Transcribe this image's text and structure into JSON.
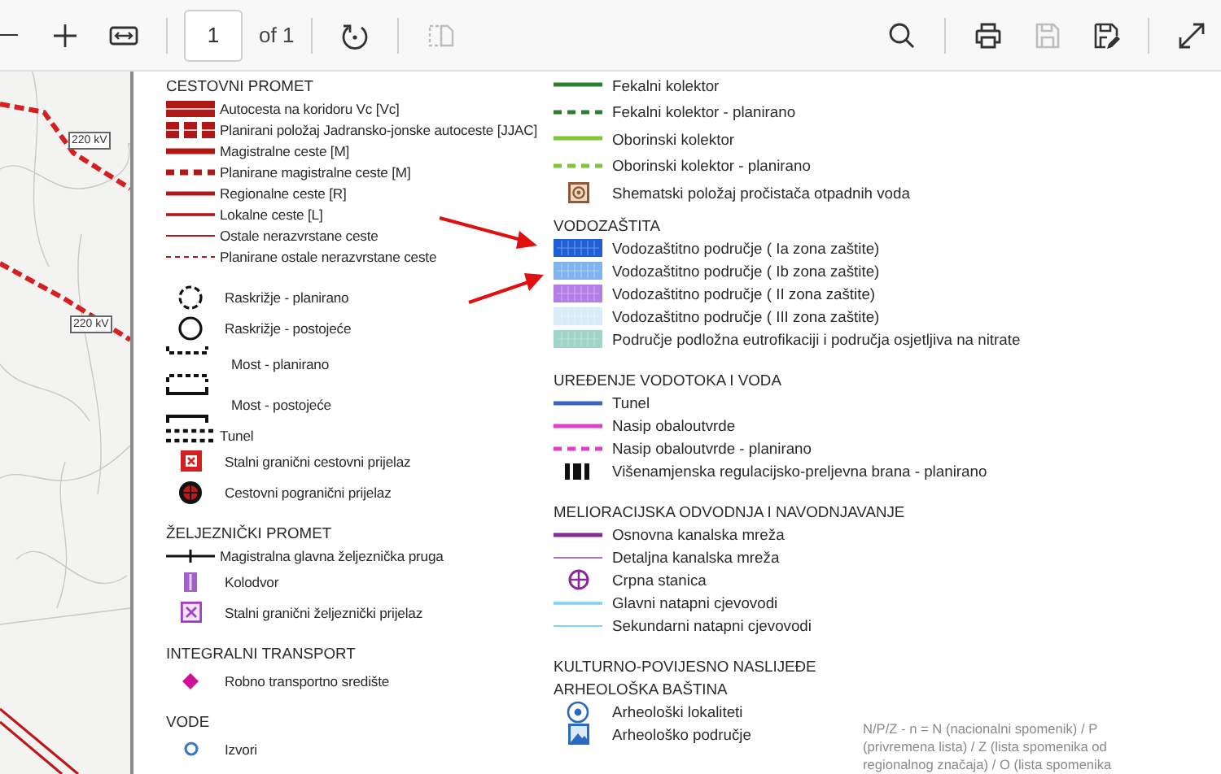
{
  "toolbar": {
    "buttons_left": [
      {
        "kind": "zoom-out",
        "disabled": false
      },
      {
        "kind": "zoom-in",
        "disabled": false
      },
      {
        "kind": "fit-width",
        "disabled": false
      }
    ],
    "page_input": {
      "value": "1"
    },
    "page_count": "of 1",
    "buttons_middle": [
      {
        "kind": "rotate",
        "disabled": false
      },
      {
        "kind": "two-page",
        "disabled": true
      }
    ],
    "buttons_right": [
      {
        "kind": "search",
        "disabled": false
      },
      {
        "kind": "print",
        "disabled": false
      },
      {
        "kind": "save",
        "disabled": true
      },
      {
        "kind": "save-as",
        "disabled": false
      },
      {
        "kind": "fullscreen",
        "disabled": false
      }
    ]
  },
  "map": {
    "labels": [
      "220 kV",
      "220 kV"
    ]
  },
  "legend": {
    "columns": [
      [
        {
          "title": "CESTOVNI PROMET",
          "items": [
            {
              "label": "Autocesta na koridoru Vc [Vc]",
              "kind": "band",
              "color": "#b01818"
            },
            {
              "label": "Planirani položaj Jadransko-jonske autoceste [JJAC]",
              "kind": "band-dashed",
              "color": "#b01818"
            },
            {
              "label": "Magistralne ceste [M]",
              "kind": "line-thick",
              "color": "#b01818"
            },
            {
              "label": "Planirane magistralne ceste [M]",
              "kind": "line-thick-dashed",
              "color": "#b01818"
            },
            {
              "label": "Regionalne ceste [R]",
              "kind": "line",
              "color": "#b01818"
            },
            {
              "label": "Lokalne ceste [L]",
              "kind": "line-medium",
              "color": "#b01818"
            },
            {
              "label": "Ostale nerazvrstane ceste",
              "kind": "line-thin",
              "color": "#b01818"
            },
            {
              "label": "Planirane ostale nerazvrstane ceste",
              "kind": "line-thin-dashed",
              "color": "#b01818"
            }
          ]
        },
        {
          "items": [
            {
              "label": "Raskrižje - planirano",
              "kind": "circle-dashed",
              "color": "#111111"
            },
            {
              "label": "Raskrižje - postojeće",
              "kind": "circle",
              "color": "#111111"
            },
            {
              "label": "Most - planirano",
              "kind": "bridge-dashed",
              "color": "#111111"
            },
            {
              "label": "Most - postojeće",
              "kind": "bridge",
              "color": "#111111"
            },
            {
              "label": "Tunel",
              "kind": "tunnel",
              "color": "#111111"
            },
            {
              "label": "Stalni granični cestovni prijelaz",
              "kind": "cross-square",
              "color": "#d42020"
            },
            {
              "label": "Cestovni pogranični prijelaz",
              "kind": "cross-circle",
              "color": "#c01818"
            }
          ]
        },
        {
          "title": "ŽELJEZNIČKI PROMET",
          "items": [
            {
              "label": "Magistralna glavna željeznička pruga",
              "kind": "rail",
              "color": "#111111"
            },
            {
              "label": "Kolodvor",
              "kind": "station",
              "color": "#a060c8"
            },
            {
              "label": "Stalni granični željeznički prijelaz",
              "kind": "cross-square-outline",
              "color": "#a040c8"
            }
          ]
        },
        {
          "title": "INTEGRALNI TRANSPORT",
          "items": [
            {
              "label": "Robno transportno središte",
              "kind": "diamond",
              "color": "#d0109a"
            }
          ]
        },
        {
          "title": "VODE",
          "items": [
            {
              "label": "Izvori",
              "kind": "ring",
              "color": "#3a78c0"
            }
          ]
        }
      ],
      [
        {
          "items": [
            {
              "label": "Fekalni kolektor",
              "kind": "line",
              "color": "#2e7d32"
            },
            {
              "label": "Fekalni kolektor - planirano",
              "kind": "line-dashed",
              "color": "#2e7d32"
            },
            {
              "label": "Oborinski kolektor",
              "kind": "line",
              "color": "#7cc832"
            },
            {
              "label": "Oborinski kolektor - planirano",
              "kind": "line-dashed",
              "color": "#7cc832"
            },
            {
              "label": "Shematski položaj pročistača otpadnih voda",
              "kind": "target-square",
              "color": "#8a5a3a"
            }
          ]
        },
        {
          "title": "VODOZAŠTITA",
          "items": [
            {
              "label": "Vodozaštitno područje ( Ia zona zaštite)",
              "kind": "swatch",
              "color": "#1f5fd6"
            },
            {
              "label": "Vodozaštitno područje ( Ib zona zaštite)",
              "kind": "swatch",
              "color": "#80b4f0"
            },
            {
              "label": "Vodozaštitno područje ( II zona zaštite)",
              "kind": "swatch",
              "color": "#b47ee6"
            },
            {
              "label": "Vodozaštitno područje ( III zona zaštite)",
              "kind": "swatch",
              "color": "#d8ecf8"
            },
            {
              "label": "Područje podložna eutrofikaciji i područja osjetljiva na nitrate",
              "kind": "swatch",
              "color": "#a0d4c8"
            }
          ]
        },
        {
          "title": "UREĐENJE VODOTOKA I VODA",
          "items": [
            {
              "label": "Tunel",
              "kind": "line",
              "color": "#3a66c0"
            },
            {
              "label": "Nasip obaloutvrde",
              "kind": "line",
              "color": "#e040d0"
            },
            {
              "label": "Nasip obaloutvrde - planirano",
              "kind": "line-dashed",
              "color": "#e040d0"
            },
            {
              "label": "Višenamjenska regulacijsko-preljevna brana - planirano",
              "kind": "blocks",
              "color": "#111111"
            }
          ]
        },
        {
          "title": "MELIORACIJSKA ODVODNJA I NAVODNJAVANJE",
          "items": [
            {
              "label": "Osnovna kanalska mreža",
              "kind": "line",
              "color": "#8a2a9a"
            },
            {
              "label": "Detaljna kanalska mreža",
              "kind": "line-thin",
              "color": "#b070c0"
            },
            {
              "label": "Crpna stanica",
              "kind": "plus-circle",
              "color": "#8a2a9a"
            },
            {
              "label": "Glavni natapni cjevovodi",
              "kind": "line-medium",
              "color": "#80d4f0"
            },
            {
              "label": "Sekundarni natapni cjevovodi",
              "kind": "line-thin",
              "color": "#80d4f0"
            }
          ]
        },
        {
          "title": "KULTURNO-POVIJESNO NASLIJEĐE",
          "subtitle": "ARHEOLOŠKA BAŠTINA",
          "items": [
            {
              "label": "Arheološki lokaliteti",
              "kind": "dot-circle",
              "color": "#2a6ac0"
            },
            {
              "label": "Arheološko područje",
              "kind": "area",
              "color": "#2a6ac0"
            }
          ]
        }
      ]
    ],
    "note": [
      "N/P/Z - n = N (nacionalni spomenik) / P",
      "(privremena lista) / Z (lista spomenika od",
      "regionalnog značaja) / O (lista spomenika"
    ]
  }
}
